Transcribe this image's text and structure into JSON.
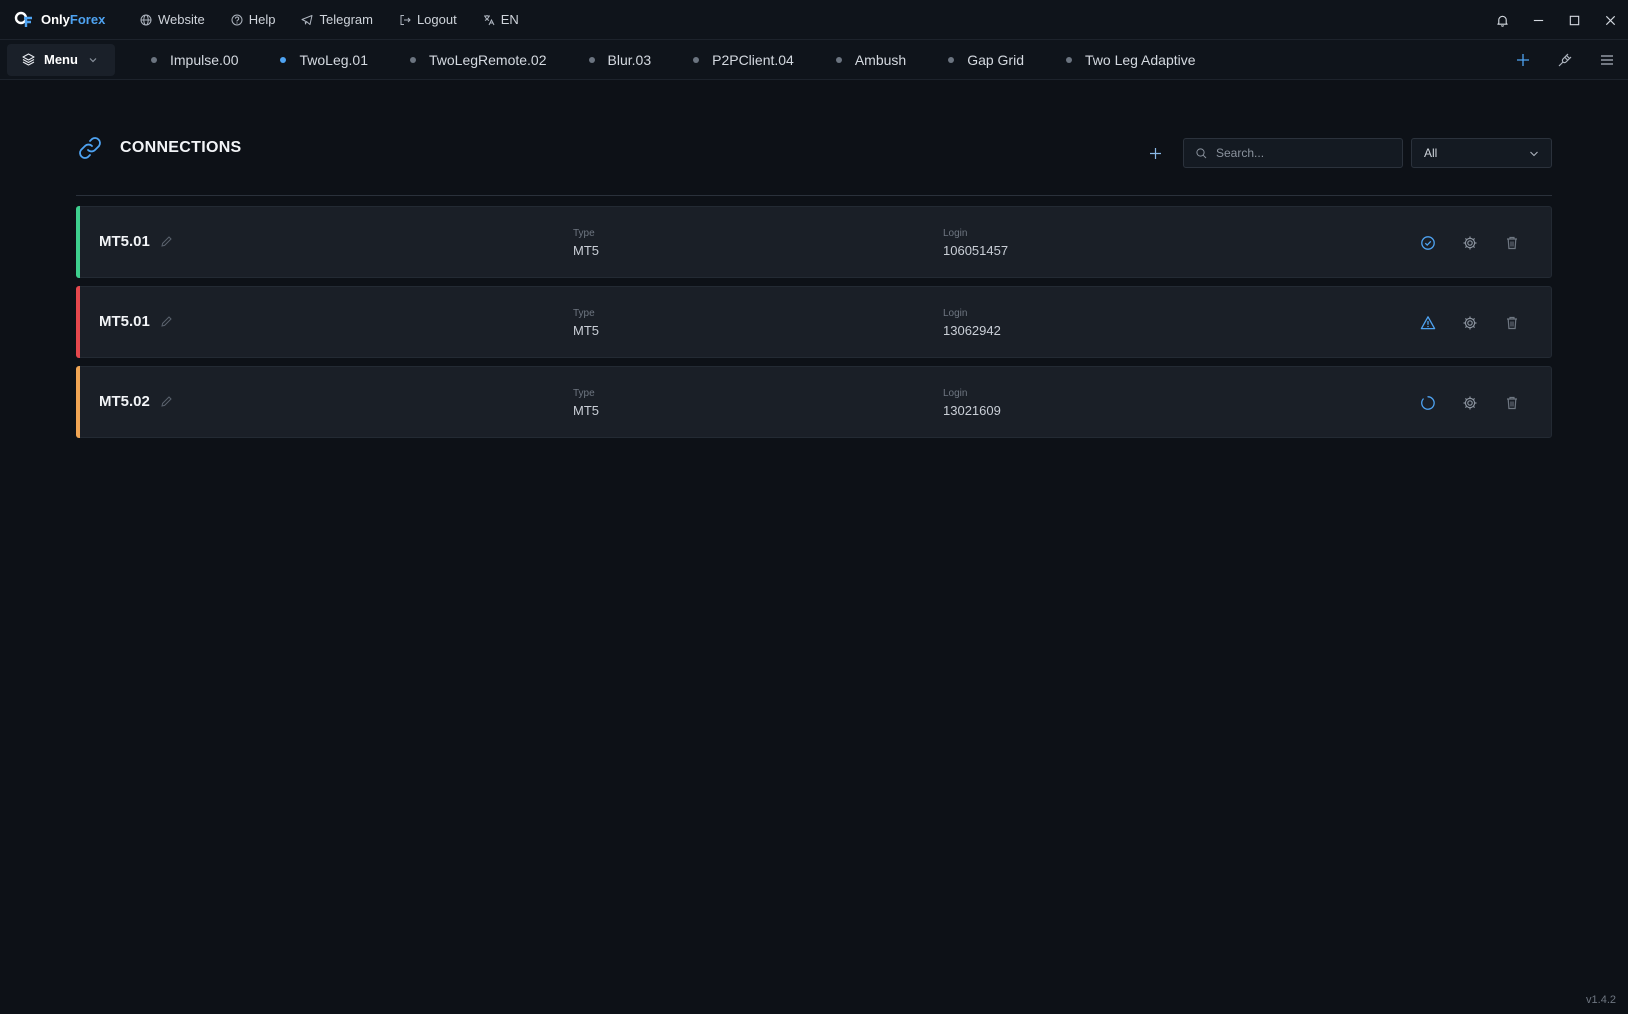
{
  "app": {
    "brand_prefix": "Only",
    "brand_accent": "Forex",
    "version": "v1.4.2"
  },
  "topnav": [
    {
      "label": "Website",
      "icon": "globe-icon"
    },
    {
      "label": "Help",
      "icon": "help-icon"
    },
    {
      "label": "Telegram",
      "icon": "telegram-icon"
    },
    {
      "label": "Logout",
      "icon": "logout-icon"
    },
    {
      "label": "EN",
      "icon": "translate-icon"
    }
  ],
  "menu": {
    "label": "Menu"
  },
  "tabs": [
    {
      "label": "Impulse.00",
      "active": false
    },
    {
      "label": "TwoLeg.01",
      "active": true
    },
    {
      "label": "TwoLegRemote.02",
      "active": false
    },
    {
      "label": "Blur.03",
      "active": false
    },
    {
      "label": "P2PClient.04",
      "active": false
    },
    {
      "label": "Ambush",
      "active": false
    },
    {
      "label": "Gap Grid",
      "active": false
    },
    {
      "label": "Two Leg Adaptive",
      "active": false
    }
  ],
  "connections": {
    "title": "CONNECTIONS",
    "search_placeholder": "Search...",
    "filter_value": "All",
    "type_label": "Type",
    "login_label": "Login",
    "items": [
      {
        "name": "MT5.01",
        "type": "MT5",
        "login": "106051457",
        "status": "connected",
        "status_icon": "check-circle-icon",
        "color": "#3ecf8e"
      },
      {
        "name": "MT5.01",
        "type": "MT5",
        "login": "13062942",
        "status": "error",
        "status_icon": "warning-icon",
        "color": "#e5484d"
      },
      {
        "name": "MT5.02",
        "type": "MT5",
        "login": "13021609",
        "status": "connecting",
        "status_icon": "loading-icon",
        "color": "#f0a554"
      }
    ]
  },
  "colors": {
    "accent": "#4ea3f2",
    "background": "#0d1117",
    "card": "#1a1f27"
  }
}
